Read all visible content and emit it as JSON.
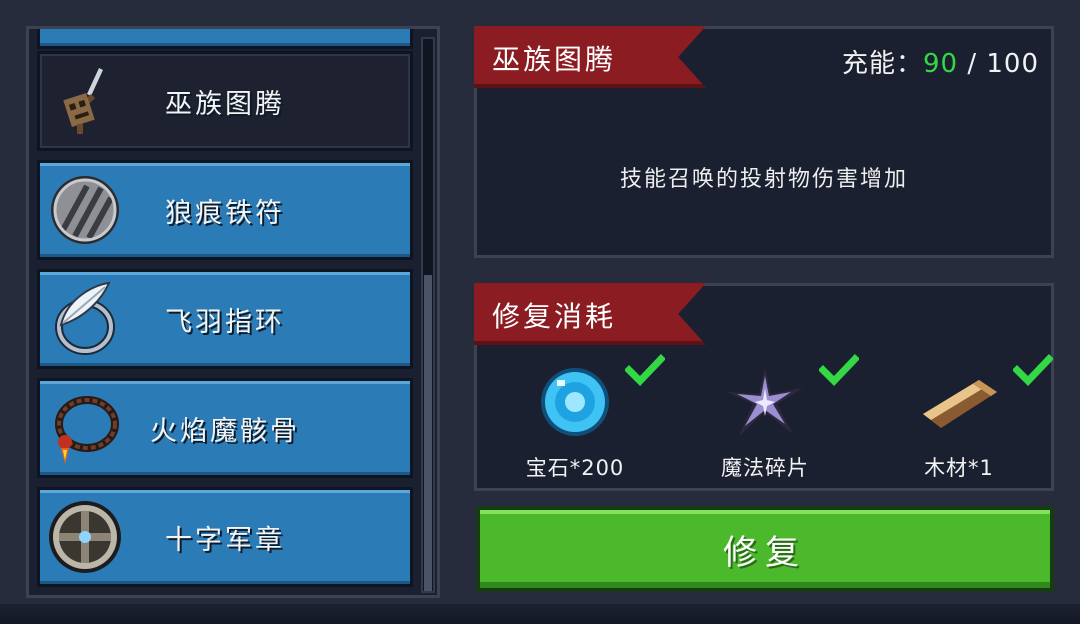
{
  "items": [
    {
      "label": "巫族图腾",
      "icon": "totem-dagger-icon",
      "selected": true
    },
    {
      "label": "狼痕铁符",
      "icon": "iron-talisman-icon",
      "selected": false
    },
    {
      "label": "飞羽指环",
      "icon": "feather-ring-icon",
      "selected": false
    },
    {
      "label": "火焰魔骸骨",
      "icon": "flame-bone-necklace-icon",
      "selected": false
    },
    {
      "label": "十字军章",
      "icon": "crusader-badge-icon",
      "selected": false
    }
  ],
  "info": {
    "title": "巫族图腾",
    "charge_label": "充能：",
    "charge_current": "90",
    "charge_separator": " / ",
    "charge_max": "100",
    "description": "技能召唤的投射物伤害增加"
  },
  "cost": {
    "title": "修复消耗",
    "materials": [
      {
        "label": "宝石*200",
        "icon": "gem-icon",
        "satisfied": true
      },
      {
        "label": "魔法碎片",
        "icon": "magic-shard-icon",
        "satisfied": true
      },
      {
        "label": "木材*1",
        "icon": "wood-icon",
        "satisfied": true
      }
    ]
  },
  "repair_button": "修复",
  "colors": {
    "accent_red": "#8b1d22",
    "item_blue": "#2a7bb6",
    "confirm_green": "#4cb82b",
    "check_green": "#33d844"
  }
}
